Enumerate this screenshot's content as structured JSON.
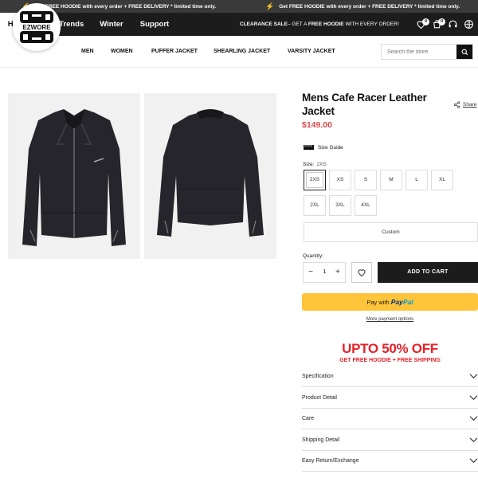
{
  "announcement": {
    "messages": [
      "Get FREE HOODIE with every order + FREE DELIVERY * limited time only.",
      "Get FREE HOODIE with every order + FREE DELIVERY * limited time only."
    ]
  },
  "topnav": {
    "tabs": [
      "Home",
      "Top Trends",
      "Winter",
      "Support"
    ],
    "active_tab": "Home",
    "promo_bold1": "CLEARANCE SALE",
    "promo_mid": "– GET A ",
    "promo_bold2": "FREE HOODIE",
    "promo_end": " WITH EVERY ORDER!",
    "wishlist_count": "0",
    "cart_count": "0"
  },
  "header": {
    "logo_text": "EZWORE",
    "nav": [
      "MEN",
      "WOMEN",
      "PUFFER JACKET",
      "SHEARLING JACKET",
      "VARSITY JACKET"
    ],
    "search_placeholder": "Search the store"
  },
  "product": {
    "title": "Mens Cafe Racer Leather Jacket",
    "price": "$149.00",
    "share_label": "Share",
    "size_guide_label": "Size Guide",
    "size_label": "Size:",
    "selected_size": "2XS",
    "sizes": [
      "2XS",
      "XS",
      "S",
      "M",
      "L",
      "XL",
      "2XL",
      "3XL",
      "4XL"
    ],
    "custom_label": "Custom",
    "quantity_label": "Quantity:",
    "quantity": "1",
    "add_to_cart": "ADD TO CART",
    "paypal_prefix": "Pay with",
    "paypal_brand1": "Pay",
    "paypal_brand2": "Pal",
    "more_payment": "More payment options",
    "promo_big": "UPTO 50% OFF",
    "promo_small": "GET FREE HOODIE + FREE SHIPPING",
    "accordion": [
      "Specification",
      "Product Detail",
      "Care",
      "Shipping Detail",
      "Easy Return/Exchange"
    ]
  },
  "colors": {
    "accent_red": "#e4222a",
    "price_red": "#e0474c",
    "dark": "#1c1c1c",
    "paypal_yellow": "#ffc439"
  }
}
